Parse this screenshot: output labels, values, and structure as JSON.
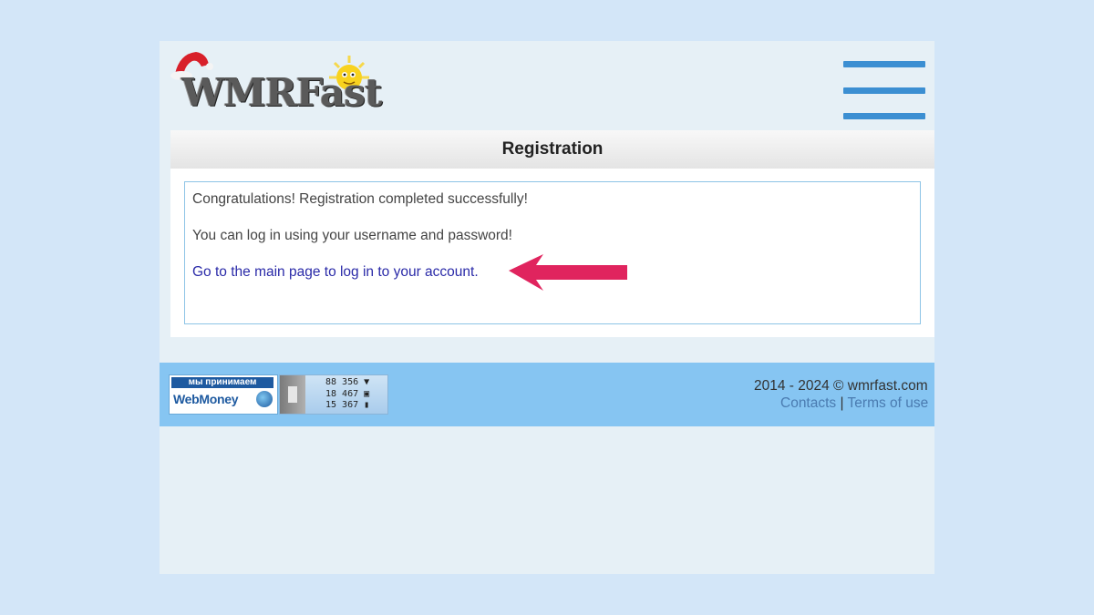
{
  "brand": {
    "logo_text": "WMRFast"
  },
  "header": {
    "menu_icon": "hamburger-menu-icon"
  },
  "panel": {
    "title": "Registration"
  },
  "messages": {
    "line1": "Congratulations! Registration completed successfully!",
    "line2": "You can log in using your username and password!",
    "link": "Go to the main page to log in to your account."
  },
  "annotation": {
    "arrow_color": "#e0245e",
    "icon": "arrow-left-icon"
  },
  "footer": {
    "webmoney_tagline": "мы принимаем",
    "webmoney_name": "WebMoney",
    "counter": {
      "rows": [
        "88 356 ▼",
        "18 467 ▣",
        "15 367 ▮"
      ]
    },
    "copyright": "2014 - 2024 © wmrfast.com",
    "contacts": "Contacts",
    "separator": "|",
    "terms": "Terms of use"
  },
  "colors": {
    "page_bg": "#d3e6f8",
    "footer_bg": "#86c5f2",
    "menu": "#3c8fd2",
    "link": "#2a2aa8"
  }
}
